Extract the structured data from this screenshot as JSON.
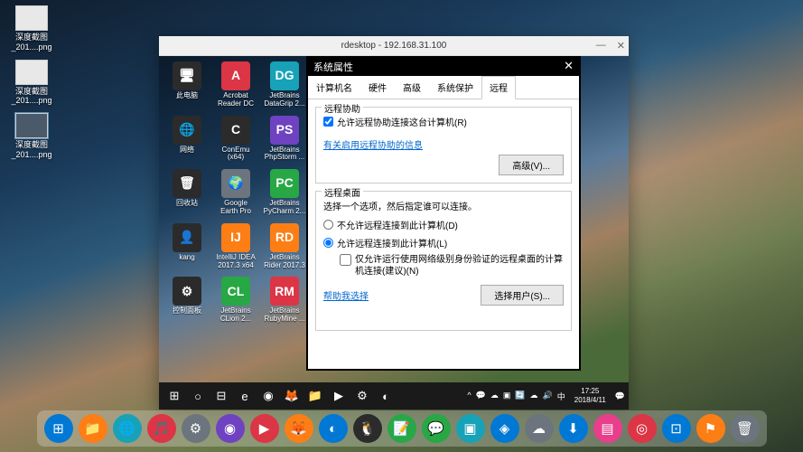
{
  "host_icons": [
    {
      "label": "深度截图\n_201....png"
    },
    {
      "label": "深度截图\n_201....png"
    },
    {
      "label": "深度截图\n_201....png",
      "selected": true
    }
  ],
  "rdesktop": {
    "title": "rdesktop - 192.168.31.100",
    "minimize": "—",
    "close": "✕"
  },
  "remote_icons": [
    {
      "label": "此电脑",
      "glyph": "🖥",
      "color": "c-dark"
    },
    {
      "label": "Acrobat\nReader DC",
      "glyph": "A",
      "color": "c-red"
    },
    {
      "label": "JetBrains\nDataGrip 2...",
      "glyph": "DG",
      "color": "c-teal"
    },
    {
      "label": "网络",
      "glyph": "🌐",
      "color": "c-dark"
    },
    {
      "label": "ConEmu\n(x64)",
      "glyph": "C",
      "color": "c-dark"
    },
    {
      "label": "JetBrains\nPhpStorm ...",
      "glyph": "PS",
      "color": "c-purple"
    },
    {
      "label": "回收站",
      "glyph": "🗑",
      "color": "c-dark"
    },
    {
      "label": "Google\nEarth Pro",
      "glyph": "🌍",
      "color": "c-gray"
    },
    {
      "label": "JetBrains\nPyCharm 2...",
      "glyph": "PC",
      "color": "c-green"
    },
    {
      "label": "kang",
      "glyph": "👤",
      "color": "c-dark"
    },
    {
      "label": "IntelliJ IDEA\n2017.3 x64",
      "glyph": "IJ",
      "color": "c-orange"
    },
    {
      "label": "JetBrains\nRider 2017.3",
      "glyph": "RD",
      "color": "c-orange"
    },
    {
      "label": "控制面板",
      "glyph": "⚙",
      "color": "c-dark"
    },
    {
      "label": "JetBrains\nCLion 2...",
      "glyph": "CL",
      "color": "c-green"
    },
    {
      "label": "JetBrains\nRubyMine ...",
      "glyph": "RM",
      "color": "c-red"
    }
  ],
  "sysprops": {
    "title": "系统属性",
    "close": "✕",
    "tabs": [
      "计算机名",
      "硬件",
      "高级",
      "系统保护",
      "远程"
    ],
    "active_tab": 4,
    "remote_assist": {
      "legend": "远程协助",
      "checkbox": "允许远程协助连接这台计算机(R)",
      "link": "有关启用远程协助的信息",
      "advanced_btn": "高级(V)..."
    },
    "remote_desktop": {
      "legend": "远程桌面",
      "instruction": "选择一个选项，然后指定谁可以连接。",
      "radio_deny": "不允许远程连接到此计算机(D)",
      "radio_allow": "允许远程连接到此计算机(L)",
      "nla_checkbox": "仅允许运行使用网络级别身份验证的远程桌面的计算机连接(建议)(N)",
      "help_link": "帮助我选择",
      "select_users_btn": "选择用户(S)..."
    }
  },
  "win_taskbar": {
    "items": [
      "⊞",
      "○",
      "⊟",
      "e",
      "◉",
      "🦊",
      "📁",
      "▶",
      "⚙",
      "◐"
    ],
    "tray": [
      "^",
      "💬",
      "☁",
      "▣",
      "🔄",
      "☁",
      "🔊",
      "中"
    ],
    "time": "17:25",
    "date": "2018/4/11"
  },
  "dock": {
    "items": [
      {
        "glyph": "⊞",
        "color": "c-blue"
      },
      {
        "glyph": "📁",
        "color": "c-orange"
      },
      {
        "glyph": "🌐",
        "color": "c-teal"
      },
      {
        "glyph": "🎵",
        "color": "c-red"
      },
      {
        "glyph": "⚙",
        "color": "c-gray"
      },
      {
        "glyph": "◉",
        "color": "c-purple"
      },
      {
        "glyph": "▶",
        "color": "c-red"
      },
      {
        "glyph": "🦊",
        "color": "c-orange"
      },
      {
        "glyph": "◐",
        "color": "c-blue"
      },
      {
        "glyph": "🐧",
        "color": "c-dark"
      },
      {
        "glyph": "📝",
        "color": "c-green"
      },
      {
        "glyph": "💬",
        "color": "c-green"
      },
      {
        "glyph": "▣",
        "color": "c-teal"
      },
      {
        "glyph": "◈",
        "color": "c-blue"
      },
      {
        "glyph": "☁",
        "color": "c-gray"
      },
      {
        "glyph": "⬇",
        "color": "c-blue"
      },
      {
        "glyph": "▤",
        "color": "c-pink"
      },
      {
        "glyph": "◎",
        "color": "c-red"
      },
      {
        "glyph": "⊡",
        "color": "c-blue"
      },
      {
        "glyph": "⚑",
        "color": "c-orange"
      },
      {
        "glyph": "🗑",
        "color": "c-gray"
      }
    ]
  }
}
